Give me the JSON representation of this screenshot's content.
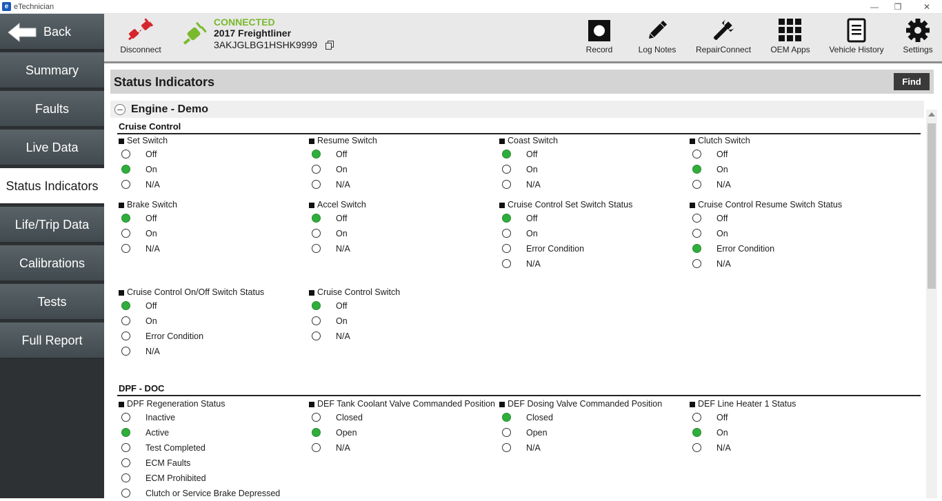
{
  "window": {
    "title": "eTechnician"
  },
  "sidebar": {
    "back_label": "Back",
    "items": [
      {
        "label": "Summary"
      },
      {
        "label": "Faults"
      },
      {
        "label": "Live Data"
      },
      {
        "label": "Status Indicators"
      },
      {
        "label": "Life/Trip Data"
      },
      {
        "label": "Calibrations"
      },
      {
        "label": "Tests"
      },
      {
        "label": "Full Report"
      }
    ],
    "active_index": 3
  },
  "toolbar": {
    "disconnect_label": "Disconnect",
    "status": "CONNECTED",
    "vehicle": "2017 Freightliner",
    "vin": "3AKJGLBG1HSHK9999",
    "buttons": [
      {
        "label": "Record",
        "icon": "record-icon"
      },
      {
        "label": "Log Notes",
        "icon": "pencil-icon"
      },
      {
        "label": "RepairConnect",
        "icon": "wrench-icon"
      },
      {
        "label": "OEM Apps",
        "icon": "grid-icon"
      },
      {
        "label": "Vehicle History",
        "icon": "document-icon"
      },
      {
        "label": "Settings",
        "icon": "gear-icon"
      }
    ]
  },
  "content": {
    "title": "Status Indicators",
    "find_label": "Find",
    "group_title": "Engine - Demo",
    "sections": [
      {
        "title": "Cruise Control",
        "indicators": [
          {
            "title": "Set Switch",
            "options": [
              "Off",
              "On",
              "N/A"
            ],
            "selected": 1
          },
          {
            "title": "Resume Switch",
            "options": [
              "Off",
              "On",
              "N/A"
            ],
            "selected": 0
          },
          {
            "title": "Coast Switch",
            "options": [
              "Off",
              "On",
              "N/A"
            ],
            "selected": 0
          },
          {
            "title": "Clutch Switch",
            "options": [
              "Off",
              "On",
              "N/A"
            ],
            "selected": 1
          },
          {
            "title": "Brake Switch",
            "options": [
              "Off",
              "On",
              "N/A"
            ],
            "selected": 0
          },
          {
            "title": "Accel Switch",
            "options": [
              "Off",
              "On",
              "N/A"
            ],
            "selected": 0
          },
          {
            "title": "Cruise Control Set Switch Status",
            "options": [
              "Off",
              "On",
              "Error Condition",
              "N/A"
            ],
            "selected": 0
          },
          {
            "title": "Cruise Control Resume Switch Status",
            "options": [
              "Off",
              "On",
              "Error Condition",
              "N/A"
            ],
            "selected": 2
          },
          {
            "title": "Cruise Control On/Off Switch Status",
            "options": [
              "Off",
              "On",
              "Error Condition",
              "N/A"
            ],
            "selected": 0
          },
          {
            "title": "Cruise Control Switch",
            "options": [
              "Off",
              "On",
              "N/A"
            ],
            "selected": 0
          }
        ]
      },
      {
        "title": "DPF - DOC",
        "indicators": [
          {
            "title": "DPF Regeneration Status",
            "options": [
              "Inactive",
              "Active",
              "Test Completed",
              "ECM Faults",
              "ECM Prohibited",
              "Clutch or Service Brake Depressed"
            ],
            "selected": 1
          },
          {
            "title": "DEF Tank Coolant Valve Commanded Position",
            "options": [
              "Closed",
              "Open",
              "N/A"
            ],
            "selected": 1
          },
          {
            "title": "DEF Dosing Valve Commanded Position",
            "options": [
              "Closed",
              "Open",
              "N/A"
            ],
            "selected": 0
          },
          {
            "title": "DEF Line Heater 1 Status",
            "options": [
              "Off",
              "On",
              "N/A"
            ],
            "selected": 1
          }
        ]
      }
    ]
  },
  "colors": {
    "connected": "#7ab92e",
    "indicator_on": "#2fae3b",
    "disconnect": "#d6262d"
  }
}
